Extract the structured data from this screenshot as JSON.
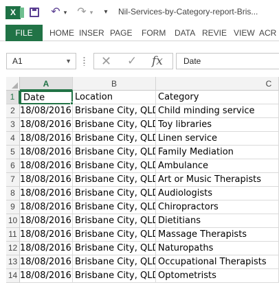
{
  "titlebar": {
    "app_icon": "excel-icon",
    "doc_title": "Nil-Services-by-Category-report-Bris..."
  },
  "ribbon": {
    "file_label": "FILE",
    "tabs": [
      "HOME",
      "INSER",
      "PAGE",
      "FORM",
      "DATA",
      "REVIE",
      "VIEW",
      "ACR"
    ]
  },
  "formula_bar": {
    "name_box": "A1",
    "content": "Date",
    "fx_label": "fx"
  },
  "sheet": {
    "columns": [
      "A",
      "B",
      "C"
    ],
    "selected_column": "A",
    "selected_row": "1",
    "rows": [
      {
        "num": "1",
        "a": "Date",
        "b": "Location",
        "c": "Category"
      },
      {
        "num": "2",
        "a": "18/08/2016",
        "b": "Brisbane City, QLD",
        "c": "Child minding service"
      },
      {
        "num": "3",
        "a": "18/08/2016",
        "b": "Brisbane City, QLD",
        "c": "Toy libraries"
      },
      {
        "num": "4",
        "a": "18/08/2016",
        "b": "Brisbane City, QLD",
        "c": "Linen service"
      },
      {
        "num": "5",
        "a": "18/08/2016",
        "b": "Brisbane City, QLD",
        "c": "Family Mediation"
      },
      {
        "num": "6",
        "a": "18/08/2016",
        "b": "Brisbane City, QLD",
        "c": "Ambulance"
      },
      {
        "num": "7",
        "a": "18/08/2016",
        "b": "Brisbane City, QLD",
        "c": "Art or Music Therapists"
      },
      {
        "num": "8",
        "a": "18/08/2016",
        "b": "Brisbane City, QLD",
        "c": "Audiologists"
      },
      {
        "num": "9",
        "a": "18/08/2016",
        "b": "Brisbane City, QLD",
        "c": "Chiropractors"
      },
      {
        "num": "10",
        "a": "18/08/2016",
        "b": "Brisbane City, QLD",
        "c": "Dietitians"
      },
      {
        "num": "11",
        "a": "18/08/2016",
        "b": "Brisbane City, QLD",
        "c": "Massage Therapists"
      },
      {
        "num": "12",
        "a": "18/08/2016",
        "b": "Brisbane City, QLD",
        "c": "Naturopaths"
      },
      {
        "num": "13",
        "a": "18/08/2016",
        "b": "Brisbane City, QLD",
        "c": "Occupational Therapists"
      },
      {
        "num": "14",
        "a": "18/08/2016",
        "b": "Brisbane City, QLD",
        "c": "Optometrists"
      }
    ]
  },
  "colors": {
    "excel_green": "#217346",
    "quick_access_purple": "#5a3e91"
  }
}
